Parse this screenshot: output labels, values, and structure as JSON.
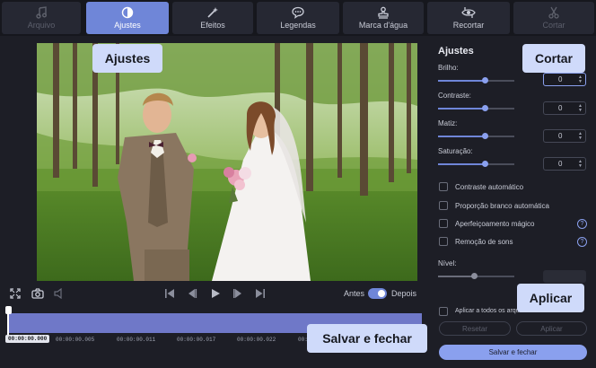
{
  "tabs": [
    {
      "label": "Arquivo",
      "icon": "music-note-icon",
      "state": "dim"
    },
    {
      "label": "Ajustes",
      "icon": "contrast-icon",
      "state": "active"
    },
    {
      "label": "Efeitos",
      "icon": "magic-wand-icon",
      "state": "normal"
    },
    {
      "label": "Legendas",
      "icon": "speech-bubble-icon",
      "state": "normal"
    },
    {
      "label": "Marca d'água",
      "icon": "stamp-icon",
      "state": "normal"
    },
    {
      "label": "Recortar",
      "icon": "crop-eye-icon",
      "state": "normal"
    },
    {
      "label": "Cortar",
      "icon": "scissors-icon",
      "state": "dim"
    }
  ],
  "controls": {
    "before_label": "Antes",
    "after_label": "Depois"
  },
  "timeline": {
    "current": "00:00:00.000",
    "ticks": [
      "00:00:00.005",
      "00:00:00.011",
      "00:00:00.017",
      "00:00:00.022",
      "00:00:00.028"
    ]
  },
  "panel": {
    "title": "Ajustes",
    "sliders": [
      {
        "label": "Brilho:",
        "value": "0",
        "level": 0.62
      },
      {
        "label": "Contraste:",
        "value": "0",
        "level": 0.62
      },
      {
        "label": "Matiz:",
        "value": "0",
        "level": 0.62
      },
      {
        "label": "Saturação:",
        "value": "0",
        "level": 0.62
      }
    ],
    "checks": [
      {
        "label": "Contraste automático",
        "help": false
      },
      {
        "label": "Proporção branco automática",
        "help": false
      },
      {
        "label": "Aperfeiçoamento mágico",
        "help": true
      },
      {
        "label": "Remoção de sons",
        "help": true
      }
    ],
    "level_label": "Nível:",
    "level_value": 0.48,
    "apply_all_label": "Aplicar a todos os arquivos",
    "reset_label": "Resetar",
    "apply_label": "Aplicar",
    "save_close_label": "Salvar e fechar"
  },
  "callouts": {
    "ajustes": "Ajustes",
    "cortar": "Cortar",
    "aplicar": "Aplicar",
    "salvar": "Salvar e fechar"
  },
  "colors": {
    "accent": "#6f86d8",
    "callout_bg": "#cfdafa",
    "background": "#1d1e26"
  }
}
